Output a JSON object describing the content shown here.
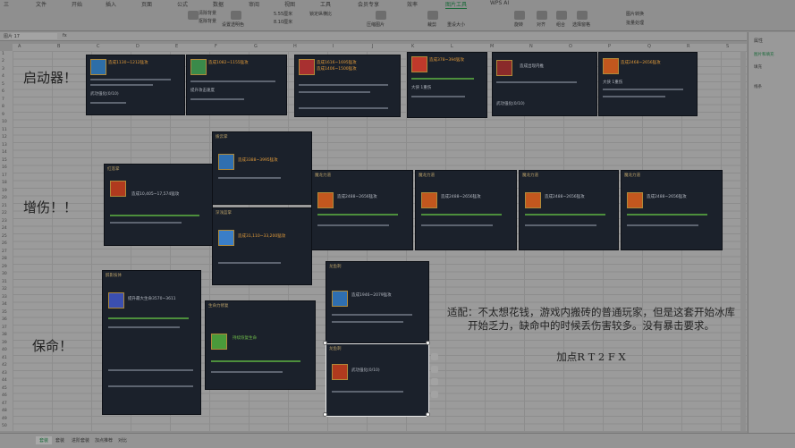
{
  "ribbon": {
    "tabs": [
      "三",
      "文件",
      "开始",
      "插入",
      "页面",
      "公式",
      "数据",
      "审阅",
      "视图",
      "工具",
      "会员专享",
      "效率",
      "图片工具",
      "WPS AI"
    ],
    "active_tab": "图片工具",
    "groups": [
      "清除背景",
      "抠除背景",
      "设置透明色",
      "压缩图片",
      "裁剪",
      "重设大小",
      "旋转",
      "对齐",
      "组合",
      "选择窗格",
      "图片转换",
      "批量处理"
    ],
    "sizes": [
      "5.55厘米",
      "8.10厘米"
    ],
    "lock": "锁定纵横比"
  },
  "formula_bar": {
    "name_box": "图片 17",
    "fx": "fx"
  },
  "columns": [
    "A",
    "B",
    "C",
    "D",
    "E",
    "F",
    "G",
    "H",
    "I",
    "J",
    "K",
    "L",
    "M",
    "N",
    "O",
    "P",
    "Q",
    "R",
    "S",
    "T"
  ],
  "rows": [
    "1",
    "2",
    "3",
    "4",
    "5",
    "6",
    "7",
    "8",
    "9",
    "10",
    "11",
    "12",
    "13",
    "14",
    "15",
    "16",
    "17",
    "18",
    "19",
    "20",
    "21",
    "22",
    "23",
    "24",
    "25",
    "26",
    "27",
    "28",
    "29",
    "30",
    "31",
    "32",
    "33",
    "34",
    "35",
    "36",
    "37",
    "38",
    "39",
    "40",
    "41",
    "42",
    "43",
    "44",
    "45",
    "46",
    "47",
    "48",
    "49",
    "50"
  ],
  "labels": {
    "start": "启动器！",
    "damage": "增伤！！",
    "save": "保命！"
  },
  "note": {
    "body": "适配：不太想花钱，游戏内搬砖的普通玩家，但是这套开始冰库开始乏力，缺命中的时候丢伤害较多。没有暴击要求。",
    "points": "加点R T 2 F X"
  },
  "cards": {
    "c1": {
      "title": "造成1130~1212猛攻",
      "sub": "武功强化(0/10)"
    },
    "c2": {
      "title": "造成1082~1155猛攻",
      "sub": "提升攻击速度"
    },
    "c3": {
      "title": "造成1616~1695猛攻",
      "sub": "造成1406~1500猛攻"
    },
    "c4": {
      "title": "造成378~394猛攻",
      "sub": "大侠 1重伤"
    },
    "c5": {
      "title": "造成出现内推",
      "sub": "武功强化(0/10)"
    },
    "c6": {
      "title": "造成2468~2656猛攻",
      "sub": "大侠 1重伤"
    },
    "c7": {
      "title": "红莲掌",
      "sub": "造成10,405~17,574猛攻"
    },
    "c8": {
      "title": "拨云掌",
      "sub": "造成3388~3995猛攻"
    },
    "c9": {
      "title": "深浅蓝掌",
      "sub": "造成31,110~33,200猛攻"
    },
    "c10": {
      "title": "魔龙力道",
      "sub": "造成2488~2656猛攻"
    },
    "c11": {
      "title": "魔龙力道",
      "sub": "造成2488~2656猛攻"
    },
    "c12": {
      "title": "魔龙力道",
      "sub": "造成2488~2656猛攻"
    },
    "c13": {
      "title": "魔龙力道",
      "sub": "造成2488~2656猛攻"
    },
    "c14": {
      "title": "魔龙力道",
      "sub": "造成2488~2656猛攻"
    },
    "c15": {
      "title": "醉影技体",
      "sub": "提升最大生命3570~3611"
    },
    "c16": {
      "title": "生命力修复",
      "sub": "持续恢复生命"
    },
    "c17": {
      "title": "龙鱼刺",
      "sub": "造成1946~2079猛攻"
    },
    "c18": {
      "title": "龙鱼刺",
      "sub": "武功强化(0/10)"
    }
  },
  "sheets": [
    "套装",
    "套装",
    "进阶套装",
    "加点推荐",
    "对比"
  ],
  "active_sheet": "套装",
  "side_panel": {
    "title": "属性",
    "tab": "图片和填充",
    "items": [
      "填充",
      "线条"
    ]
  }
}
